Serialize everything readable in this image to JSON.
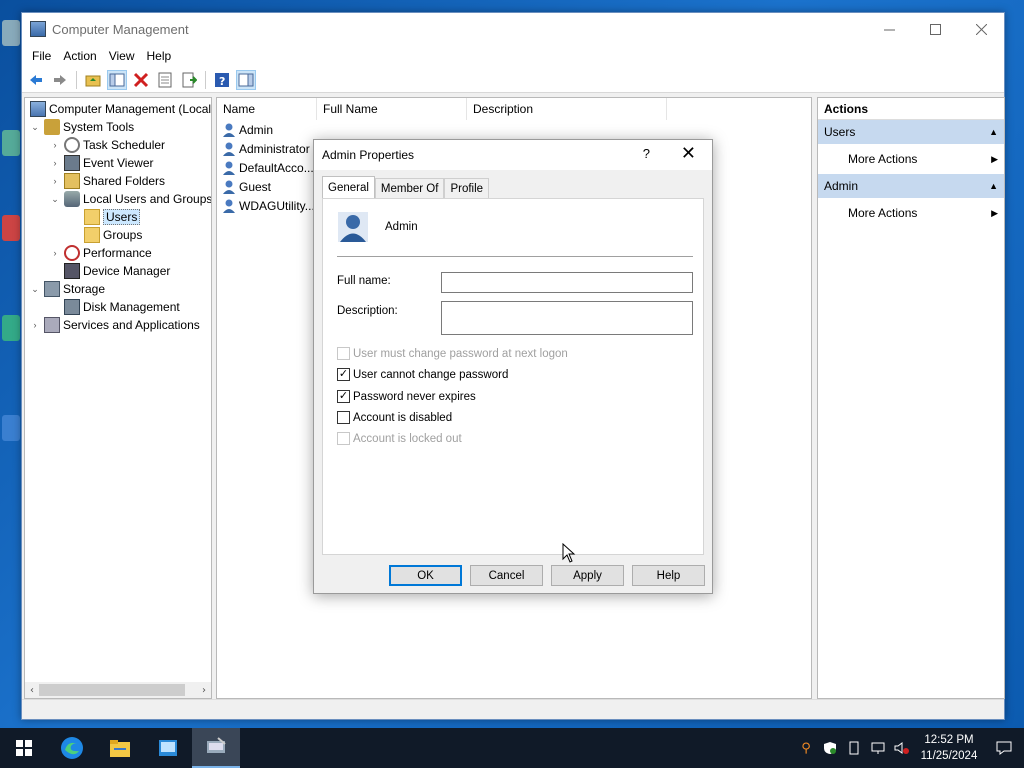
{
  "window": {
    "title": "Computer Management"
  },
  "menu": [
    "File",
    "Action",
    "View",
    "Help"
  ],
  "tree": {
    "root": "Computer Management (Local",
    "system_tools": "System Tools",
    "task_scheduler": "Task Scheduler",
    "event_viewer": "Event Viewer",
    "shared_folders": "Shared Folders",
    "local_users_groups": "Local Users and Groups",
    "users": "Users",
    "groups": "Groups",
    "performance": "Performance",
    "device_manager": "Device Manager",
    "storage": "Storage",
    "disk_management": "Disk Management",
    "services_apps": "Services and Applications"
  },
  "list": {
    "columns": [
      "Name",
      "Full Name",
      "Description"
    ],
    "rows": [
      "Admin",
      "Administrator",
      "DefaultAcco...",
      "Guest",
      "WDAGUtility..."
    ]
  },
  "actions": {
    "title": "Actions",
    "section1": "Users",
    "section1_item": "More Actions",
    "section2": "Admin",
    "section2_item": "More Actions"
  },
  "dialog": {
    "title": "Admin Properties",
    "help_glyph": "?",
    "close_glyph": "✕",
    "tabs": [
      "General",
      "Member Of",
      "Profile"
    ],
    "user_name": "Admin",
    "full_name_label": "Full name:",
    "full_name_value": "",
    "description_label": "Description:",
    "description_value": "",
    "checkboxes": [
      {
        "label": "User must change password at next logon",
        "checked": false,
        "disabled": true
      },
      {
        "label": "User cannot change password",
        "checked": true,
        "disabled": false
      },
      {
        "label": "Password never expires",
        "checked": true,
        "disabled": false
      },
      {
        "label": "Account is disabled",
        "checked": false,
        "disabled": false
      },
      {
        "label": "Account is locked out",
        "checked": false,
        "disabled": true
      }
    ],
    "buttons": {
      "ok": "OK",
      "cancel": "Cancel",
      "apply": "Apply",
      "help": "Help"
    }
  },
  "taskbar": {
    "time": "12:52 PM",
    "date": "11/25/2024"
  },
  "colors": {
    "accent": "#0078d7",
    "selection": "#cce8ff",
    "actions_header": "#c6d9ef",
    "taskbar": "#101a28"
  }
}
